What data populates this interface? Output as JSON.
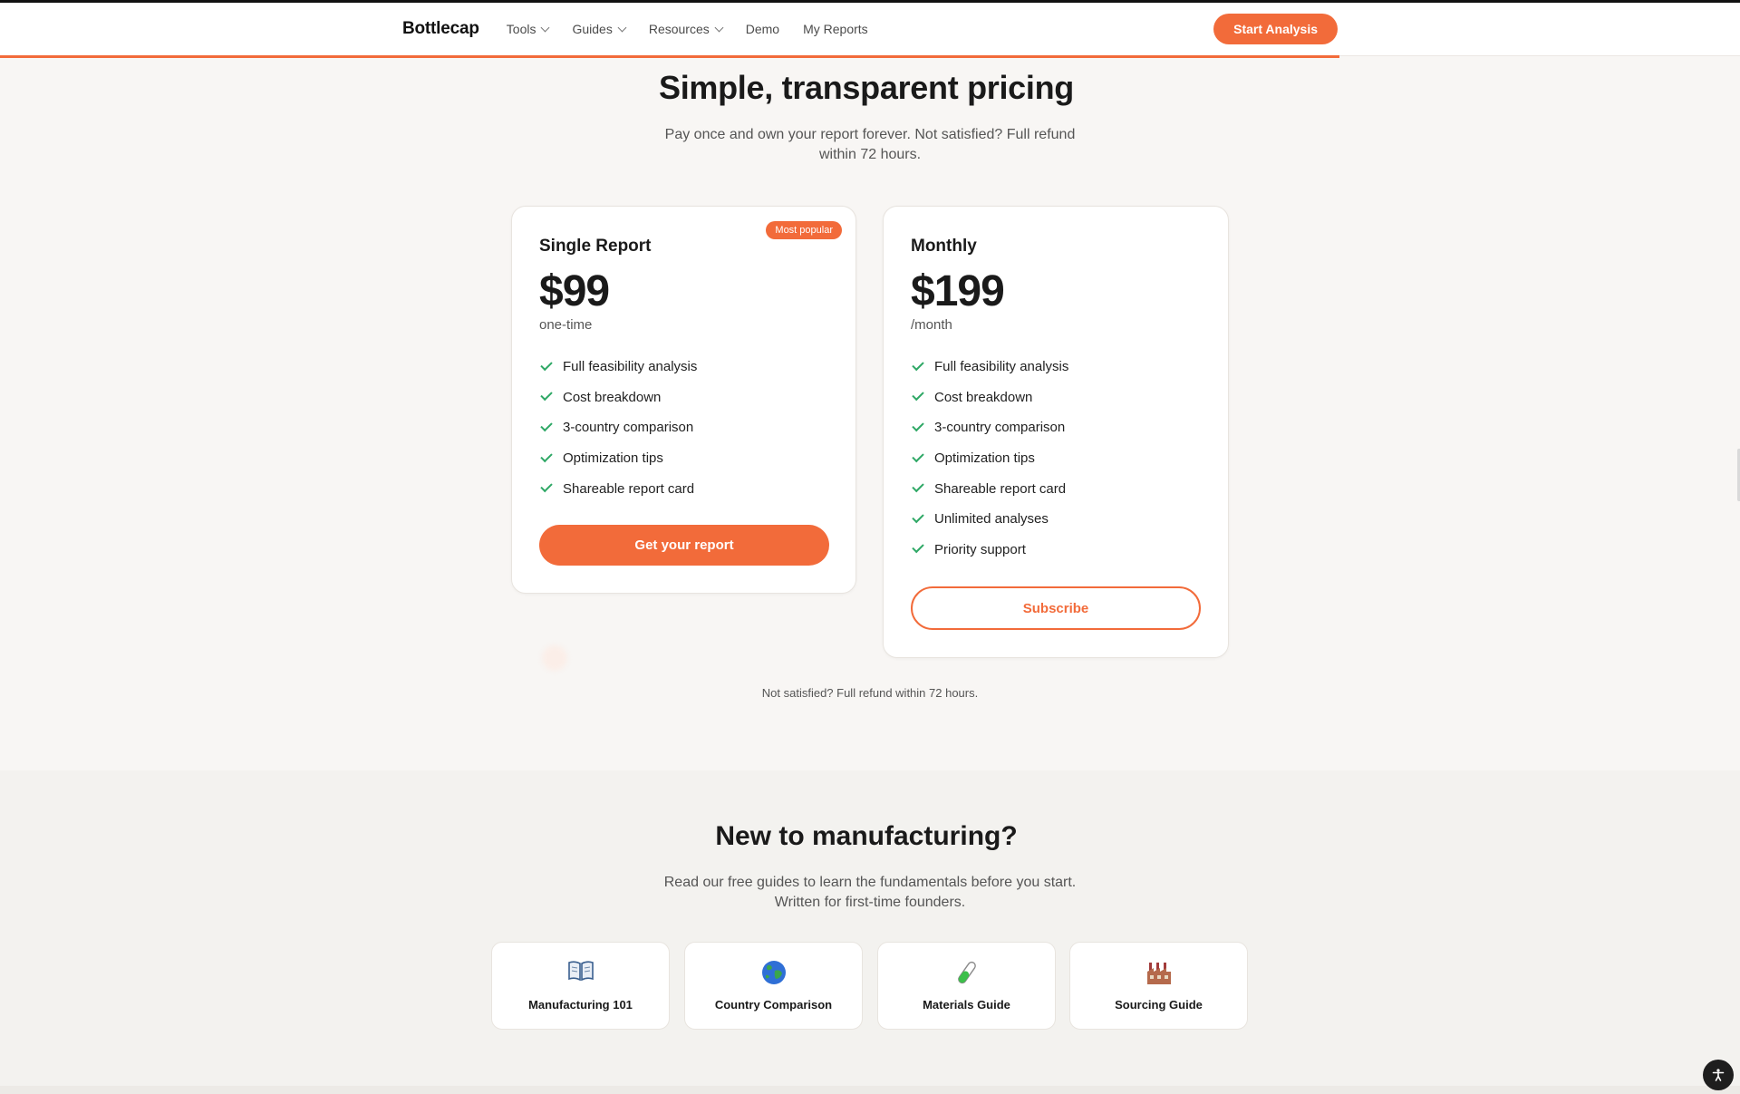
{
  "nav": {
    "brand": "Bottlecap",
    "links": [
      {
        "label": "Tools"
      },
      {
        "label": "Guides"
      },
      {
        "label": "Resources"
      },
      {
        "label": "Demo"
      },
      {
        "label": "My Reports"
      }
    ],
    "cta": "Start Analysis"
  },
  "pricing": {
    "title": "Simple, transparent pricing",
    "subtitle_line1": "Pay once and own your report forever. Not satisfied? Full refund",
    "subtitle_line2": "within 72 hours.",
    "plans": [
      {
        "name": "Single Report",
        "badge": "Most popular",
        "price": "$99",
        "period": "one-time",
        "features": [
          "Full feasibility analysis",
          "Cost breakdown",
          "3-country comparison",
          "Optimization tips",
          "Shareable report card"
        ],
        "button": "Get your report"
      },
      {
        "name": "Monthly",
        "price": "$199",
        "period": "/month",
        "features": [
          "Full feasibility analysis",
          "Cost breakdown",
          "3-country comparison",
          "Optimization tips",
          "Shareable report card",
          "Unlimited analyses",
          "Priority support"
        ],
        "button": "Subscribe"
      }
    ],
    "refund_note": "Not satisfied? Full refund within 72 hours."
  },
  "guides": {
    "title": "New to manufacturing?",
    "subtitle_line1": "Read our free guides to learn the fundamentals before you start.",
    "subtitle_line2": "Written for first-time founders.",
    "cards": [
      {
        "icon": "book-icon",
        "label": "Manufacturing 101"
      },
      {
        "icon": "globe-icon",
        "label": "Country Comparison"
      },
      {
        "icon": "test-tube-icon",
        "label": "Materials Guide"
      },
      {
        "icon": "factory-icon",
        "label": "Sourcing Guide"
      }
    ]
  },
  "colors": {
    "accent": "#f26b3a",
    "check": "#2fa866",
    "text": "#1a1a1a",
    "muted": "#555555",
    "page_bg": "#f8f6f4"
  }
}
